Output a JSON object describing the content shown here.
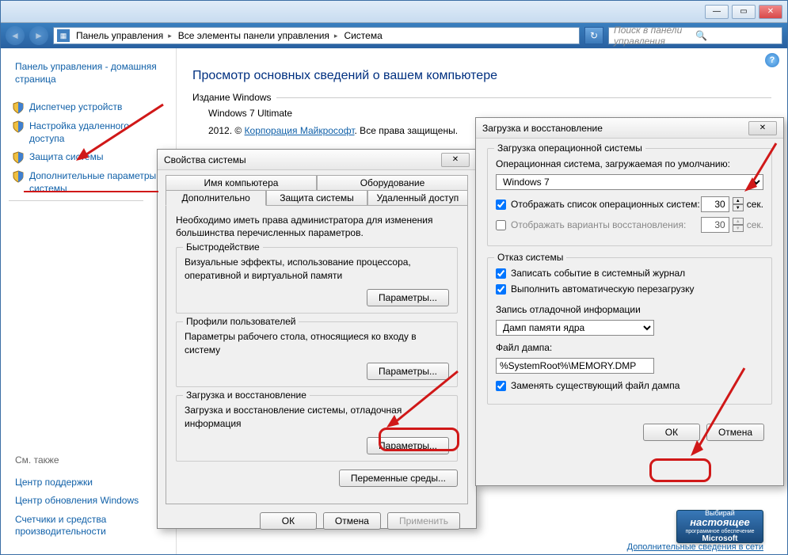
{
  "titlebar": {
    "min": "—",
    "max": "▭",
    "close": "✕"
  },
  "breadcrumb": {
    "items": [
      "Панель управления",
      "Все элементы панели управления",
      "Система"
    ]
  },
  "search": {
    "placeholder": "Поиск в панели управления"
  },
  "sidebar": {
    "home": "Панель управления - домашняя страница",
    "links": [
      "Диспетчер устройств",
      "Настройка удаленного доступа",
      "Защита системы",
      "Дополнительные параметры системы"
    ],
    "see_also": "См. также",
    "footer_links": [
      "Центр поддержки",
      "Центр обновления Windows",
      "Счетчики и средства производительности"
    ]
  },
  "main": {
    "title": "Просмотр основных сведений о вашем компьютере",
    "edition_label": "Издание Windows",
    "edition": "Windows 7 Ultimate",
    "copyright_prefix": "2012. © ",
    "copyright_link": "Корпорация Майкрософт",
    "copyright_suffix": ". Все права защищены.",
    "more_info": "Дополнительные сведения в сети"
  },
  "badge": {
    "line1": "Выбирай",
    "line2": "настоящее",
    "line3": "программное обеспечение",
    "line4": "Microsoft"
  },
  "sysprops": {
    "title": "Свойства системы",
    "tabs_row1": [
      "Имя компьютера",
      "Оборудование"
    ],
    "tabs_row2": [
      "Дополнительно",
      "Защита системы",
      "Удаленный доступ"
    ],
    "desc": "Необходимо иметь права администратора для изменения большинства перечисленных параметров.",
    "perf": {
      "title": "Быстродействие",
      "desc": "Визуальные эффекты, использование процессора, оперативной и виртуальной памяти",
      "btn": "Параметры..."
    },
    "profiles": {
      "title": "Профили пользователей",
      "desc": "Параметры рабочего стола, относящиеся ко входу в систему",
      "btn": "Параметры..."
    },
    "startup_grp": {
      "title": "Загрузка и восстановление",
      "desc": "Загрузка и восстановление системы, отладочная информация",
      "btn": "Параметры..."
    },
    "env_btn": "Переменные среды...",
    "ok": "ОК",
    "cancel": "Отмена",
    "apply": "Применить"
  },
  "startup": {
    "title": "Загрузка и восстановление",
    "boot": {
      "title": "Загрузка операционной системы",
      "default_label": "Операционная система, загружаемая по умолчанию:",
      "default_value": "Windows 7",
      "show_list": "Отображать список операционных систем:",
      "show_list_sec": "30",
      "show_recovery": "Отображать варианты восстановления:",
      "show_recovery_sec": "30",
      "sec_label": "сек."
    },
    "failure": {
      "title": "Отказ системы",
      "log": "Записать событие в системный журнал",
      "restart": "Выполнить автоматическую перезагрузку",
      "debug_label": "Запись отладочной информации",
      "debug_value": "Дамп памяти ядра",
      "dump_label": "Файл дампа:",
      "dump_value": "%SystemRoot%\\MEMORY.DMP",
      "overwrite": "Заменять существующий файл дампа"
    },
    "ok": "ОК",
    "cancel": "Отмена"
  }
}
